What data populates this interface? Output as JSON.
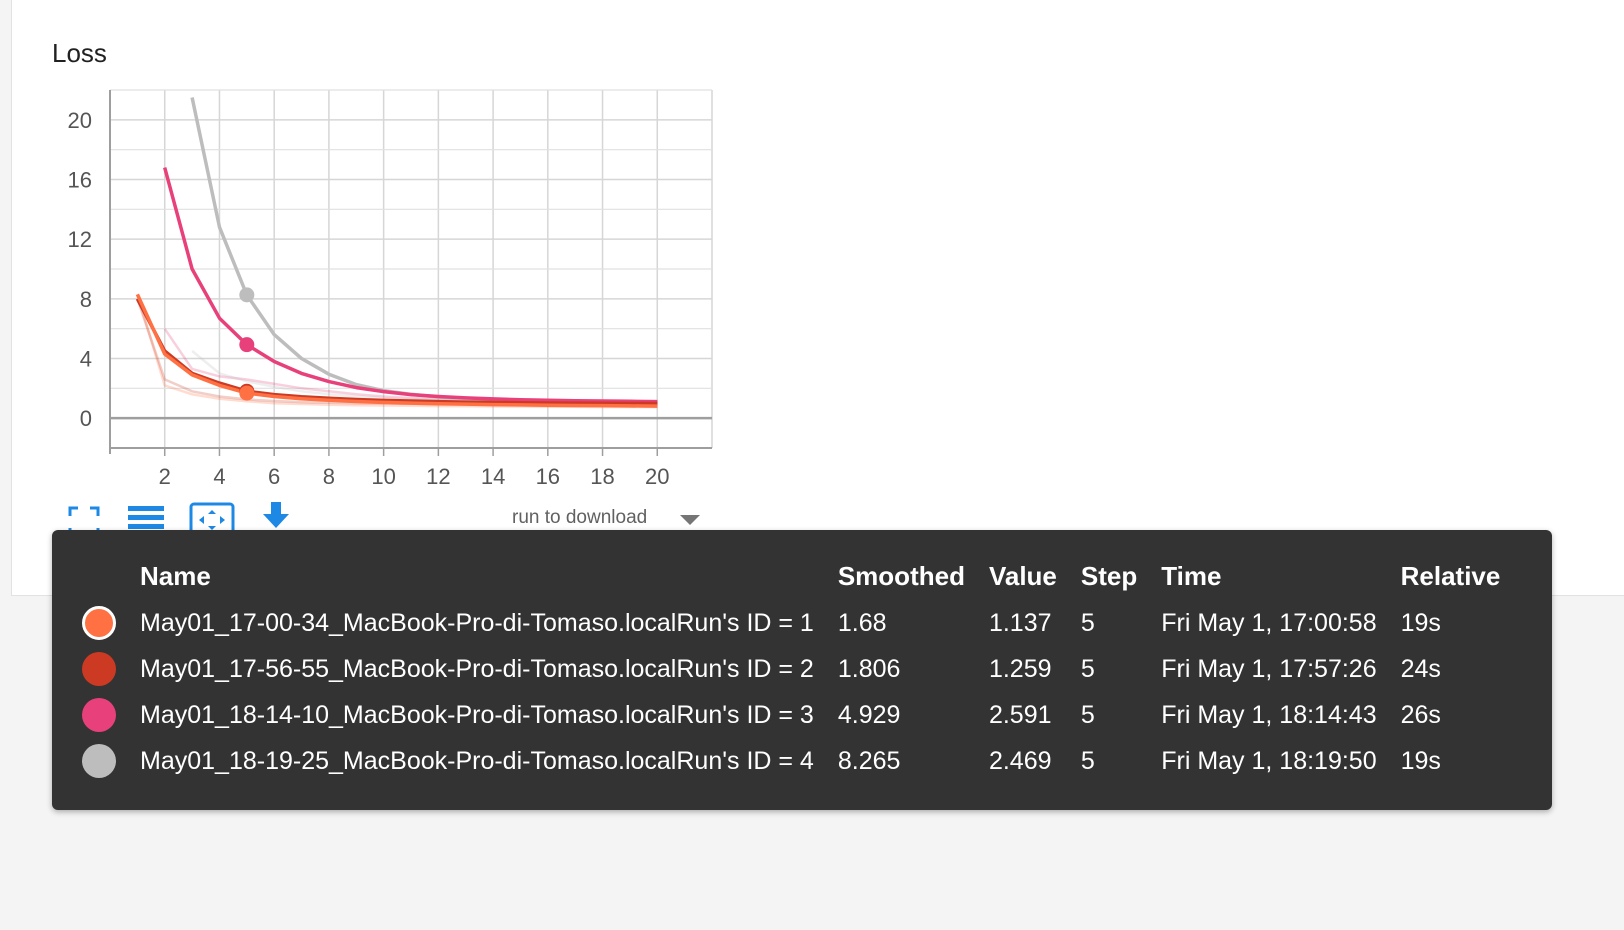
{
  "chart_title": "Loss",
  "chart_data": {
    "type": "line",
    "title": "Loss",
    "xlim": [
      0,
      22
    ],
    "ylim": [
      -2,
      22
    ],
    "xticks": [
      2,
      4,
      6,
      8,
      10,
      12,
      14,
      16,
      18,
      20
    ],
    "yticks": [
      0,
      4,
      8,
      12,
      16,
      20
    ],
    "xtick_labels": [
      "2",
      "4",
      "6",
      "8",
      "10",
      "12",
      "14",
      "16",
      "18",
      "20"
    ],
    "ytick_labels": [
      "0",
      "4",
      "8",
      "12",
      "16",
      "20"
    ],
    "grid": true,
    "hover_step": 5,
    "series": [
      {
        "color": "#ff7043",
        "x": [
          1,
          2,
          3,
          4,
          5,
          6,
          7,
          8,
          9,
          10,
          11,
          12,
          13,
          14,
          15,
          16,
          17,
          18,
          19,
          20
        ],
        "smoothed": [
          8.3,
          4.3,
          2.9,
          2.2,
          1.68,
          1.45,
          1.3,
          1.2,
          1.12,
          1.06,
          1.01,
          0.97,
          0.94,
          0.91,
          0.89,
          0.87,
          0.85,
          0.84,
          0.82,
          0.81
        ],
        "raw": [
          8.3,
          2.2,
          1.6,
          1.3,
          1.137,
          1.0,
          0.95,
          0.9,
          0.87,
          0.85,
          0.83,
          0.81,
          0.8,
          0.79,
          0.78,
          0.77,
          0.76,
          0.75,
          0.75,
          0.74
        ]
      },
      {
        "color": "#cc3a24",
        "x": [
          1,
          2,
          3,
          4,
          5,
          6,
          7,
          8,
          9,
          10,
          11,
          12,
          13,
          14,
          15,
          16,
          17,
          18,
          19,
          20
        ],
        "smoothed": [
          8.0,
          4.5,
          3.0,
          2.35,
          1.806,
          1.58,
          1.43,
          1.33,
          1.25,
          1.19,
          1.15,
          1.11,
          1.08,
          1.06,
          1.04,
          1.02,
          1.01,
          1.0,
          0.99,
          0.98
        ],
        "raw": [
          8.0,
          2.6,
          1.8,
          1.45,
          1.259,
          1.15,
          1.08,
          1.03,
          1.0,
          0.98,
          0.96,
          0.95,
          0.94,
          0.93,
          0.92,
          0.92,
          0.91,
          0.91,
          0.9,
          0.9
        ]
      },
      {
        "color": "#e8407a",
        "x": [
          2,
          3,
          4,
          5,
          6,
          7,
          8,
          9,
          10,
          11,
          12,
          13,
          14,
          15,
          16,
          17,
          18,
          19,
          20
        ],
        "smoothed": [
          16.8,
          10.0,
          6.7,
          4.929,
          3.8,
          3.0,
          2.45,
          2.05,
          1.78,
          1.58,
          1.45,
          1.36,
          1.29,
          1.24,
          1.2,
          1.17,
          1.15,
          1.13,
          1.11
        ],
        "raw": [
          6.0,
          3.3,
          2.8,
          2.591,
          2.3,
          2.0,
          1.8,
          1.6,
          1.45,
          1.35,
          1.28,
          1.22,
          1.18,
          1.15,
          1.13,
          1.12,
          1.11,
          1.1,
          1.09
        ]
      },
      {
        "color": "#bdbdbd",
        "x": [
          3,
          4,
          5,
          6,
          7,
          8,
          9,
          10,
          11,
          12,
          13,
          14,
          15,
          16,
          17,
          18,
          19,
          20
        ],
        "smoothed": [
          21.5,
          12.8,
          8.265,
          5.6,
          4.0,
          2.95,
          2.25,
          1.85,
          1.6,
          1.42,
          1.32,
          1.25,
          1.2,
          1.17,
          1.14,
          1.12,
          1.1,
          1.09
        ],
        "raw": [
          4.5,
          3.0,
          2.469,
          2.1,
          1.8,
          1.6,
          1.45,
          1.35,
          1.28,
          1.22,
          1.18,
          1.15,
          1.13,
          1.11,
          1.1,
          1.09,
          1.08,
          1.07
        ]
      }
    ]
  },
  "toolbar": {
    "fullscreen_icon": "fullscreen-icon",
    "lines_icon": "list-lines-icon",
    "fit_icon": "fit-domain-icon",
    "download_icon": "download-icon",
    "run_to_download": "run to download"
  },
  "tooltip": {
    "headers": {
      "name": "Name",
      "smoothed": "Smoothed",
      "value": "Value",
      "step": "Step",
      "time": "Time",
      "relative": "Relative"
    },
    "rows": [
      {
        "color": "#ff7043",
        "selected": true,
        "name": "May01_17-00-34_MacBook-Pro-di-Tomaso.localRun's ID = 1",
        "smoothed": "1.68",
        "value": "1.137",
        "step": "5",
        "time": "Fri May 1, 17:00:58",
        "relative": "19s"
      },
      {
        "color": "#cc3a24",
        "selected": false,
        "name": "May01_17-56-55_MacBook-Pro-di-Tomaso.localRun's ID = 2",
        "smoothed": "1.806",
        "value": "1.259",
        "step": "5",
        "time": "Fri May 1, 17:57:26",
        "relative": "24s"
      },
      {
        "color": "#e8407a",
        "selected": false,
        "name": "May01_18-14-10_MacBook-Pro-di-Tomaso.localRun's ID = 3",
        "smoothed": "4.929",
        "value": "2.591",
        "step": "5",
        "time": "Fri May 1, 18:14:43",
        "relative": "26s"
      },
      {
        "color": "#bdbdbd",
        "selected": false,
        "name": "May01_18-19-25_MacBook-Pro-di-Tomaso.localRun's ID = 4",
        "smoothed": "8.265",
        "value": "2.469",
        "step": "5",
        "time": "Fri May 1, 18:19:50",
        "relative": "19s"
      }
    ]
  }
}
